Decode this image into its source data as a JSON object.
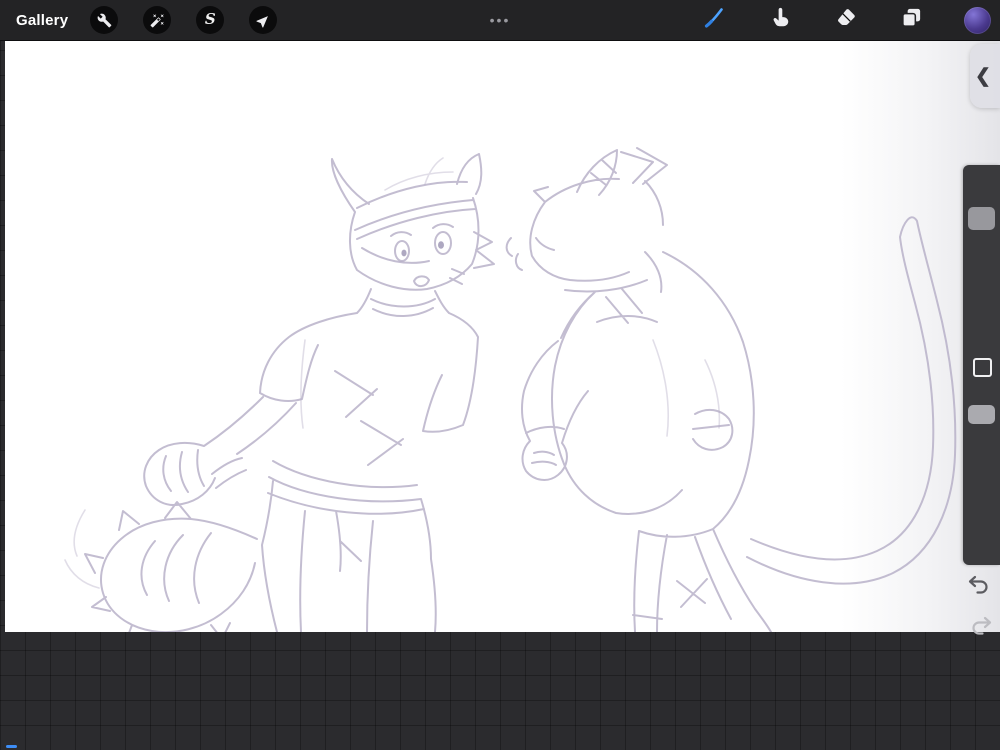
{
  "toolbar": {
    "gallery_label": "Gallery",
    "more_dots": "•••",
    "selection_glyph": "S",
    "left_tools": [
      {
        "label": "Actions",
        "icon": "wrench-icon"
      },
      {
        "label": "Adjustments",
        "icon": "magic-wand-icon"
      },
      {
        "label": "Selection",
        "icon": "s-glyph-icon"
      },
      {
        "label": "Transform",
        "icon": "arrow-cursor-icon"
      }
    ],
    "right_tools": [
      {
        "label": "Paint",
        "icon": "brush-icon",
        "active": true
      },
      {
        "label": "Smudge",
        "icon": "finger-icon",
        "active": false
      },
      {
        "label": "Erase",
        "icon": "eraser-icon",
        "active": false
      },
      {
        "label": "Layers",
        "icon": "layers-icon",
        "active": false
      },
      {
        "label": "Color",
        "icon": "color-swatch",
        "active": false
      }
    ]
  },
  "side_panel": {
    "chevron": "❮"
  },
  "side_controls": {
    "brush_size_slider": {
      "handle_visible": true
    },
    "modify_button": {
      "shape": "square-outline"
    },
    "opacity_slider": {
      "handle_visible": true
    },
    "undo": {
      "enabled": true,
      "icon": "undo-arrow-icon"
    },
    "redo": {
      "enabled": false,
      "icon": "redo-arrow-icon"
    }
  },
  "colors": {
    "accent_blue": "#3d8df5",
    "toolbar_bg": "#232325",
    "workspace_bg": "#2b2b2e",
    "color_swatch_purple": "#4b3a8f",
    "sketch_stroke": "#b4acc6"
  },
  "canvas": {
    "description": "Rough pencil sketch of two anthropomorphic cat characters: left one horned, looking back surprised in a t-shirt with fluffy tail; right one with striped horn and backpack, long curling tail"
  }
}
